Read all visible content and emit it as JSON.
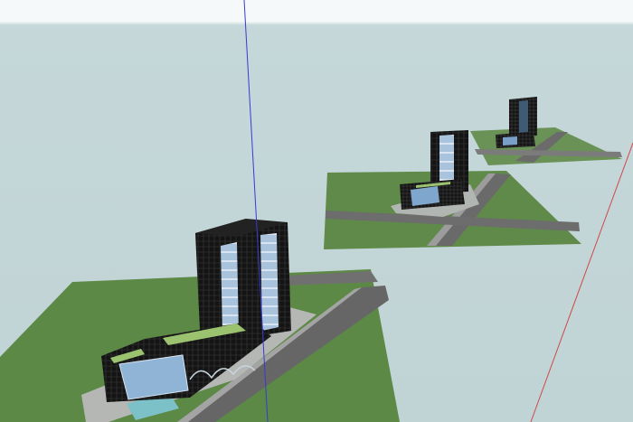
{
  "app": {
    "title": "",
    "view": "perspective",
    "colors": {
      "sky_top": "#f4f8f8",
      "sky": "#c5d7d9",
      "ground_grass": "#5f8a4a",
      "ground_grass_dark": "#4f7840",
      "road": "#6a6a6a",
      "road_light": "#9a9a9a",
      "pavement": "#b5b8b4",
      "building_dark": "#161616",
      "glass": "#8fb4d6",
      "roof_green": "#9bc26f",
      "axis_blue": "#3a3ad0",
      "axis_red": "#d04a4a"
    }
  },
  "scene": {
    "models": [
      {
        "name": "main-model",
        "description_for_icon": "office-tower-complex"
      },
      {
        "name": "middle-model",
        "description_for_icon": "office-tower-complex"
      },
      {
        "name": "far-model",
        "description_for_icon": "office-tower-complex"
      }
    ],
    "axes": [
      "blue-vertical-axis",
      "red-axis"
    ]
  }
}
